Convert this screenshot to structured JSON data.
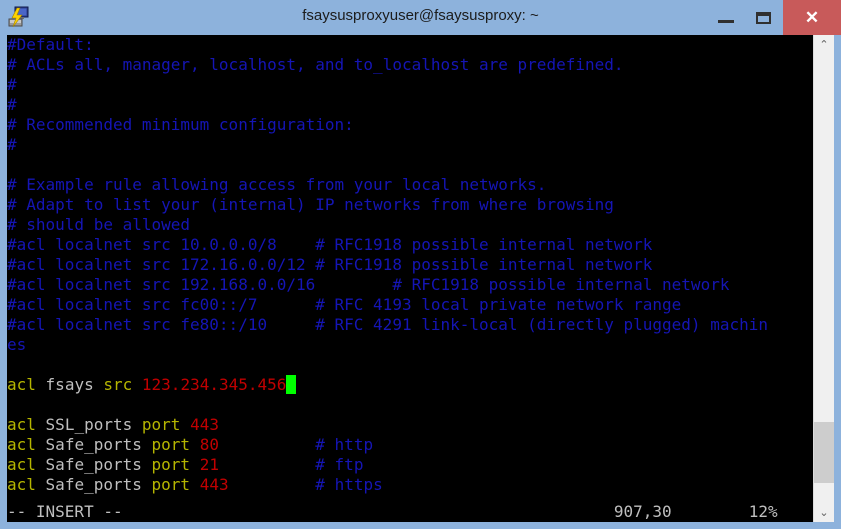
{
  "window": {
    "title": "fsaysusproxyuser@fsaysusproxy: ~",
    "icon": "putty-icon",
    "titlebar_color": "#8db2dc",
    "close_color": "#c85a5a",
    "controls": {
      "minimize_label": "—",
      "maximize_label": "□",
      "close_label": "✕"
    }
  },
  "terminal": {
    "background": "#000000",
    "foreground": "#bfbfbf",
    "cursor_color": "#00ff00",
    "comment_color": "#1515b5",
    "keyword_color": "#b5b500",
    "number_color": "#c00000",
    "columns": 80,
    "rows": 24,
    "lines": [
      [
        {
          "t": "#Default:",
          "s": "comment"
        }
      ],
      [
        {
          "t": "# ACLs all, manager, localhost, and to_localhost are predefined.",
          "s": "comment"
        }
      ],
      [
        {
          "t": "#",
          "s": "comment"
        }
      ],
      [
        {
          "t": "#",
          "s": "comment"
        }
      ],
      [
        {
          "t": "# Recommended minimum configuration:",
          "s": "comment"
        }
      ],
      [
        {
          "t": "#",
          "s": "comment"
        }
      ],
      [
        {
          "t": "",
          "s": "default"
        }
      ],
      [
        {
          "t": "# Example rule allowing access from your local networks.",
          "s": "comment"
        }
      ],
      [
        {
          "t": "# Adapt to list your (internal) IP networks from where browsing",
          "s": "comment"
        }
      ],
      [
        {
          "t": "# should be allowed",
          "s": "comment"
        }
      ],
      [
        {
          "t": "#acl localnet src 10.0.0.0/8    # RFC1918 possible internal network",
          "s": "comment"
        }
      ],
      [
        {
          "t": "#acl localnet src 172.16.0.0/12 # RFC1918 possible internal network",
          "s": "comment"
        }
      ],
      [
        {
          "t": "#acl localnet src 192.168.0.0/16        # RFC1918 possible internal network",
          "s": "comment"
        }
      ],
      [
        {
          "t": "#acl localnet src fc00::/7      # RFC 4193 local private network range",
          "s": "comment"
        }
      ],
      [
        {
          "t": "#acl localnet src fe80::/10     # RFC 4291 link-local (directly plugged) machin",
          "s": "comment"
        }
      ],
      [
        {
          "t": "es",
          "s": "comment"
        }
      ],
      [
        {
          "t": "",
          "s": "default"
        }
      ],
      [
        {
          "t": "acl",
          "s": "keyword"
        },
        {
          "t": " ",
          "s": "default"
        },
        {
          "t": "fsays",
          "s": "ident"
        },
        {
          "t": " ",
          "s": "default"
        },
        {
          "t": "src",
          "s": "keyword"
        },
        {
          "t": " ",
          "s": "default"
        },
        {
          "t": "123.234.345.456",
          "s": "number"
        },
        {
          "t": " ",
          "s": "cursor"
        }
      ],
      [
        {
          "t": "",
          "s": "default"
        }
      ],
      [
        {
          "t": "acl",
          "s": "keyword"
        },
        {
          "t": " ",
          "s": "default"
        },
        {
          "t": "SSL_ports",
          "s": "ident"
        },
        {
          "t": " ",
          "s": "default"
        },
        {
          "t": "port",
          "s": "keyword"
        },
        {
          "t": " ",
          "s": "default"
        },
        {
          "t": "443",
          "s": "number"
        }
      ],
      [
        {
          "t": "acl",
          "s": "keyword"
        },
        {
          "t": " ",
          "s": "default"
        },
        {
          "t": "Safe_ports",
          "s": "ident"
        },
        {
          "t": " ",
          "s": "default"
        },
        {
          "t": "port",
          "s": "keyword"
        },
        {
          "t": " ",
          "s": "default"
        },
        {
          "t": "80",
          "s": "number"
        },
        {
          "t": "          ",
          "s": "default"
        },
        {
          "t": "# http",
          "s": "comment"
        }
      ],
      [
        {
          "t": "acl",
          "s": "keyword"
        },
        {
          "t": " ",
          "s": "default"
        },
        {
          "t": "Safe_ports",
          "s": "ident"
        },
        {
          "t": " ",
          "s": "default"
        },
        {
          "t": "port",
          "s": "keyword"
        },
        {
          "t": " ",
          "s": "default"
        },
        {
          "t": "21",
          "s": "number"
        },
        {
          "t": "          ",
          "s": "default"
        },
        {
          "t": "# ftp",
          "s": "comment"
        }
      ],
      [
        {
          "t": "acl",
          "s": "keyword"
        },
        {
          "t": " ",
          "s": "default"
        },
        {
          "t": "Safe_ports",
          "s": "ident"
        },
        {
          "t": " ",
          "s": "default"
        },
        {
          "t": "port",
          "s": "keyword"
        },
        {
          "t": " ",
          "s": "default"
        },
        {
          "t": "443",
          "s": "number"
        },
        {
          "t": "         ",
          "s": "default"
        },
        {
          "t": "# https",
          "s": "comment"
        }
      ]
    ],
    "statusline": {
      "mode": "-- INSERT --",
      "position": "907,30",
      "percent": "12%",
      "raw": "-- INSERT --                                                   907,30        12%"
    }
  },
  "scrollbar": {
    "up_arrow": "⌃",
    "down_arrow": "⌄",
    "thumb_top_pct": 82,
    "thumb_height_pct": 13.5
  }
}
